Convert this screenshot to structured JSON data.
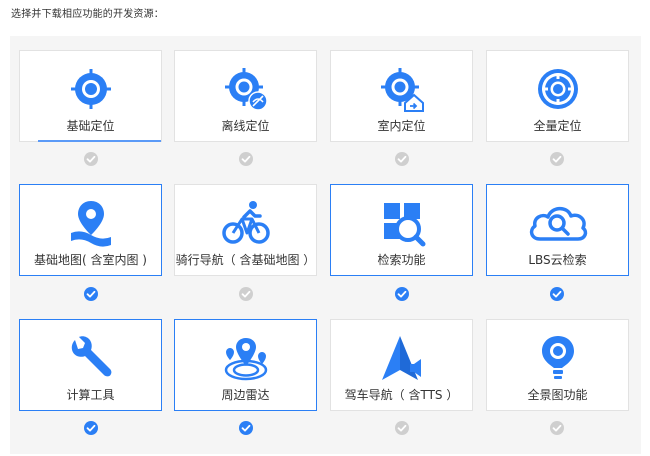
{
  "header": {
    "prompt": "选择并下载相应功能的开发资源："
  },
  "colors": {
    "accent": "#2b7ff5",
    "check_off": "#cfcfcf",
    "card_border": "#e2e2e2"
  },
  "features": [
    {
      "label": "基础定位",
      "icon": "location-crosshair-icon",
      "selected": false
    },
    {
      "label": "离线定位",
      "icon": "offline-location-icon",
      "selected": false
    },
    {
      "label": "室内定位",
      "icon": "indoor-location-icon",
      "selected": false
    },
    {
      "label": "全量定位",
      "icon": "full-location-icon",
      "selected": false
    },
    {
      "label": "基础地图( 含室内图 )",
      "icon": "map-pin-icon",
      "selected": true
    },
    {
      "label": "骑行导航（ 含基础地图 ）",
      "icon": "bicycle-icon",
      "selected": false
    },
    {
      "label": "检索功能",
      "icon": "search-grid-icon",
      "selected": true
    },
    {
      "label": "LBS云检索",
      "icon": "cloud-search-icon",
      "selected": true
    },
    {
      "label": "计算工具",
      "icon": "wrench-icon",
      "selected": true
    },
    {
      "label": "周边雷达",
      "icon": "radar-icon",
      "selected": true
    },
    {
      "label": "驾车导航（ 含TTS ）",
      "icon": "navigation-arrow-icon",
      "selected": false
    },
    {
      "label": "全景图功能",
      "icon": "panorama-pin-icon",
      "selected": false
    }
  ]
}
